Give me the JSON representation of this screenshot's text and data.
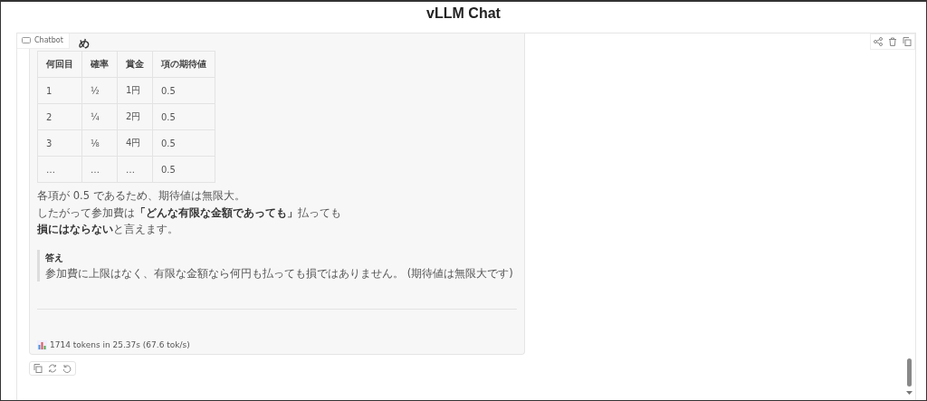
{
  "window": {
    "title": "vLLM Chat"
  },
  "chatbot": {
    "label": "Chatbot",
    "message": {
      "heading_fragment": "め",
      "table": {
        "columns": [
          "何回目",
          "確率",
          "賞金",
          "項の期待値"
        ],
        "rows": [
          [
            "1",
            "½",
            "1円",
            "0.5"
          ],
          [
            "2",
            "¼",
            "2円",
            "0.5"
          ],
          [
            "3",
            "⅛",
            "4円",
            "0.5"
          ],
          [
            "…",
            "…",
            "…",
            "0.5"
          ]
        ]
      },
      "paragraph_lines": [
        "各項が 0.5 であるため、期待値は無限大。",
        "したがって参加費は**「どんな有限な金額であっても」**払っても",
        "**損にはならない**と言えます。"
      ],
      "blockquote": {
        "title": "答え",
        "text": "参加費に上限はなく、有限な金額なら何円も払っても損ではありません。 (期待値は無限大です)"
      },
      "stats": "1714 tokens in 25.37s (67.6 tok/s)"
    }
  }
}
